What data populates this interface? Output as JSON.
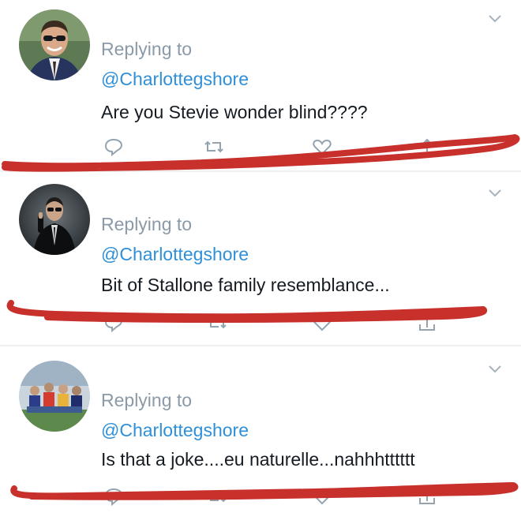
{
  "accent_color": "#2f8fd8",
  "annotation_color": "#c8302c",
  "tweets": [
    {
      "replying_label": "Replying to",
      "handle": "@Charlottegshore",
      "text": "Are you Stevie wonder blind????",
      "avatar_icon": "avatar-man-sunglasses-suit"
    },
    {
      "replying_label": "Replying to",
      "handle": "@Charlottegshore",
      "text": "Bit of Stallone family resemblance...",
      "avatar_icon": "avatar-man-dark-suit"
    },
    {
      "replying_label": "Replying to",
      "handle": "@Charlottegshore",
      "text": "Is that a joke....eu naturelle...nahhhtttttt",
      "avatar_icon": "avatar-group-photo"
    }
  ],
  "actions": [
    "reply-icon",
    "retweet-icon",
    "like-icon",
    "share-icon"
  ]
}
